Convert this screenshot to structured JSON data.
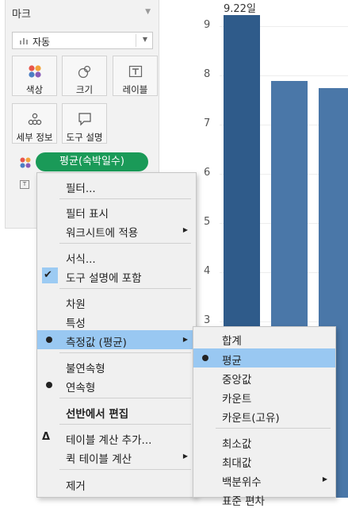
{
  "marks": {
    "title": "마크",
    "mark_type": "자동",
    "shelves": {
      "color": "색상",
      "size": "크기",
      "label": "레이블",
      "detail": "세부 정보",
      "tooltip": "도구 설명"
    },
    "pill": "평균(숙박일수)",
    "pill_color": "#1a9a58"
  },
  "chart_data": {
    "type": "bar",
    "y_ticks": [
      "9",
      "8",
      "7",
      "6",
      "5",
      "4",
      "3"
    ],
    "values": [
      9.22,
      7.88,
      7.75
    ],
    "bar_colors": [
      "#2f5b8a",
      "#4a77a8",
      "#4a77a8"
    ],
    "data_label": "9.22일",
    "grid": true
  },
  "context_menu": {
    "filter": "필터...",
    "show_filter": "필터 표시",
    "apply_to_worksheets": "워크시트에 적용",
    "format": "서식...",
    "include_in_tooltip": "도구 설명에 포함",
    "dimension": "차원",
    "attribute": "특성",
    "measure": "측정값 (평균)",
    "discrete": "불연속형",
    "continuous": "연속형",
    "edit_in_shelf": "선반에서 편집",
    "add_table_calc": "테이블 계산 추가...",
    "quick_table_calc": "퀵 테이블 계산",
    "remove": "제거",
    "delta_symbol": "Δ"
  },
  "submenu": {
    "sum": "합계",
    "average": "평균",
    "median": "중앙값",
    "count": "카운트",
    "count_distinct": "카운트(고유)",
    "minimum": "최소값",
    "maximum": "최대값",
    "percentile": "백분위수",
    "std_dev": "표준 편차"
  },
  "colors": {
    "highlight": "#99c8f2",
    "menu_bg": "#f0f0f0"
  }
}
